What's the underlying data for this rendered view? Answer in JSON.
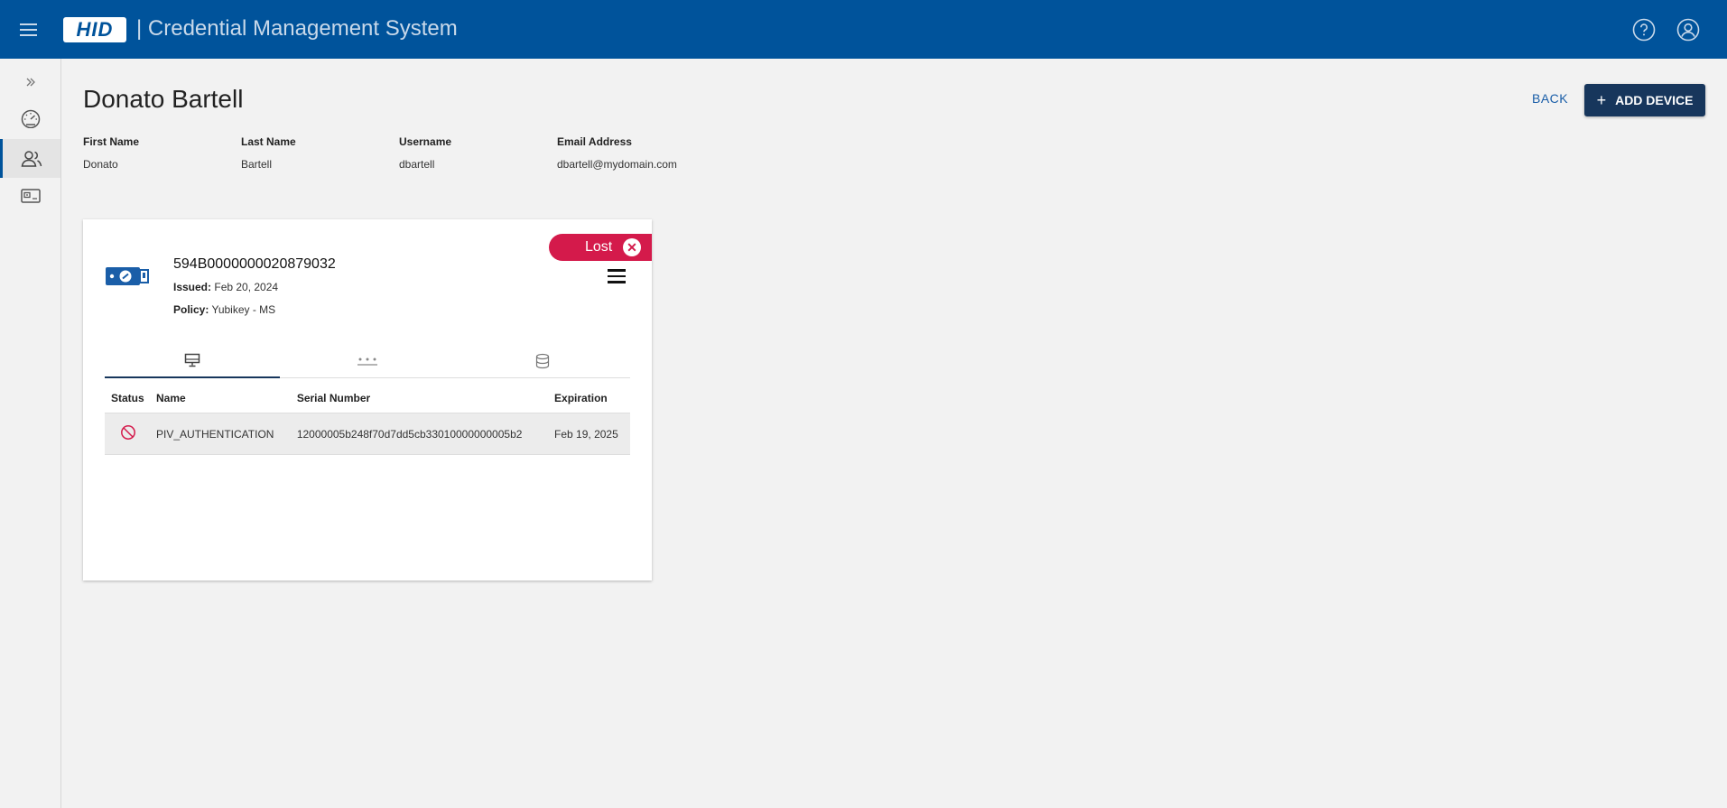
{
  "header": {
    "logo": "HID",
    "title": "| Credential Management System"
  },
  "sidebar": {
    "items": [
      {
        "icon": "chevrons-right-icon"
      },
      {
        "icon": "dashboard-icon"
      },
      {
        "icon": "users-icon",
        "active": true
      },
      {
        "icon": "card-icon"
      }
    ]
  },
  "user": {
    "display_name": "Donato Bartell",
    "fields": [
      {
        "label": "First Name",
        "value": "Donato"
      },
      {
        "label": "Last Name",
        "value": "Bartell"
      },
      {
        "label": "Username",
        "value": "dbartell"
      },
      {
        "label": "Email Address",
        "value": "dbartell@mydomain.com"
      }
    ]
  },
  "actions": {
    "back": "BACK",
    "add_device": "ADD DEVICE"
  },
  "device": {
    "serial": "594B0000000020879032",
    "issued_label": "Issued:",
    "issued_value": "Feb 20, 2024",
    "policy_label": "Policy:",
    "policy_value": "Yubikey - MS",
    "status_badge": "Lost",
    "tabs": [
      {
        "icon": "monitor-icon",
        "active": true
      },
      {
        "icon": "password-icon"
      },
      {
        "icon": "database-icon"
      }
    ],
    "table": {
      "columns": [
        "Status",
        "Name",
        "Serial Number",
        "Expiration"
      ],
      "rows": [
        {
          "status_icon": "revoked-icon",
          "name": "PIV_AUTHENTICATION",
          "serial": "12000005b248f70d7dd5cb33010000000005b2",
          "expiration": "Feb 19, 2025"
        }
      ]
    }
  },
  "colors": {
    "header_bg": "#00539b",
    "primary_button": "#17365c",
    "lost_badge": "#d41a4b",
    "link": "#1a5ea8"
  }
}
